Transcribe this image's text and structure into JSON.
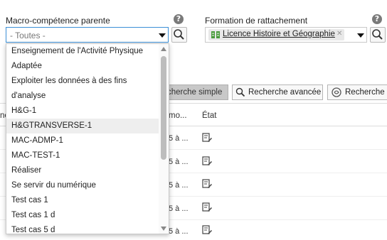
{
  "filters": {
    "macro_label": "Macro-compétence parente",
    "macro_value": "- Toutes -",
    "help_symbol": "?",
    "formation_label": "Formation de rattachement",
    "formation_tag": "Licence Histoire et Géographie",
    "tag_remove_symbol": "✕"
  },
  "buttons": {
    "simple": "cherche simple",
    "advanced": "Recherche avancée",
    "semantic": "Recherche S"
  },
  "table": {
    "col_partial_left": "ne",
    "col_mod": "mo...",
    "col_etat": "État",
    "rows": [
      {
        "mod": "5 à ..."
      },
      {
        "mod": "5 à ..."
      },
      {
        "mod": "5 à ..."
      },
      {
        "mod": "5 à ..."
      },
      {
        "mod": "5 à ..."
      }
    ]
  },
  "dropdown": {
    "options": [
      "Enseignement de l'Activité Physique",
      "Adaptée",
      "Exploiter les données à des fins",
      "d'analyse",
      "H&G-1",
      "H&GTRANSVERSE-1",
      "MAC-ADMP-1",
      "MAC-TEST-1",
      "Réaliser",
      "Se servir du numérique",
      "Test cas 1",
      "Test cas 1 d",
      "Test cas 5 d"
    ],
    "highlighted_index": 5
  },
  "colors": {
    "focus_border": "#3b8fd6",
    "tag_bg": "#e8e8e8",
    "tag_icon": "#4a9a3c",
    "highlight_row": "#eeeeee"
  }
}
